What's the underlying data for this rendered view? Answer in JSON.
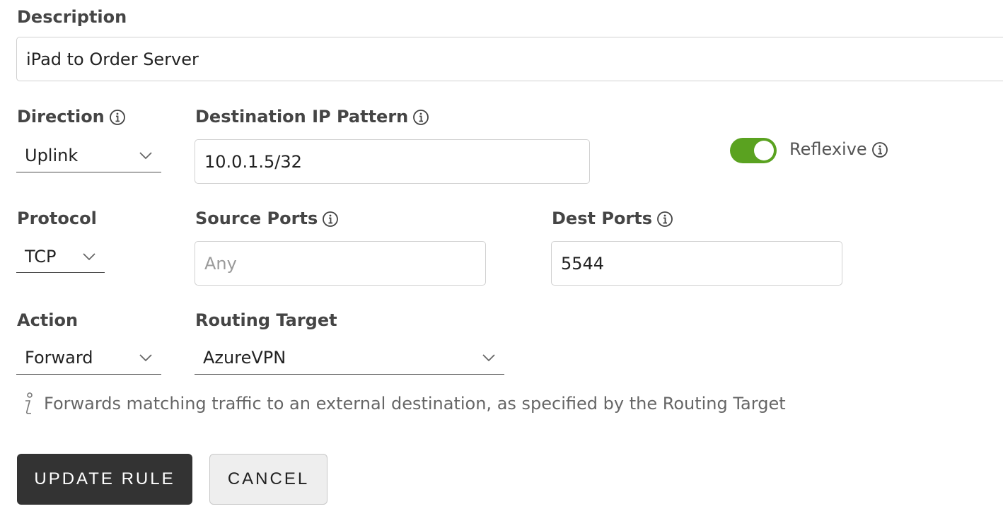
{
  "form": {
    "description": {
      "label": "Description",
      "value": "iPad to Order Server"
    },
    "direction": {
      "label": "Direction",
      "value": "Uplink"
    },
    "destination_ip": {
      "label": "Destination IP Pattern",
      "value": "10.0.1.5/32"
    },
    "reflexive": {
      "label": "Reflexive",
      "enabled": true,
      "color": "#5aa220"
    },
    "protocol": {
      "label": "Protocol",
      "value": "TCP"
    },
    "source_ports": {
      "label": "Source Ports",
      "value": "",
      "placeholder": "Any"
    },
    "dest_ports": {
      "label": "Dest Ports",
      "value": "5544"
    },
    "action": {
      "label": "Action",
      "value": "Forward"
    },
    "routing_target": {
      "label": "Routing Target",
      "value": "AzureVPN"
    },
    "help_text": "Forwards matching traffic to an external destination, as specified by the Routing Target"
  },
  "buttons": {
    "update_label": "UPDATE RULE",
    "cancel_label": "CANCEL"
  },
  "colors": {
    "primary_button": "#333333",
    "secondary_button": "#eeeeee",
    "toggle_on": "#5aa220"
  }
}
